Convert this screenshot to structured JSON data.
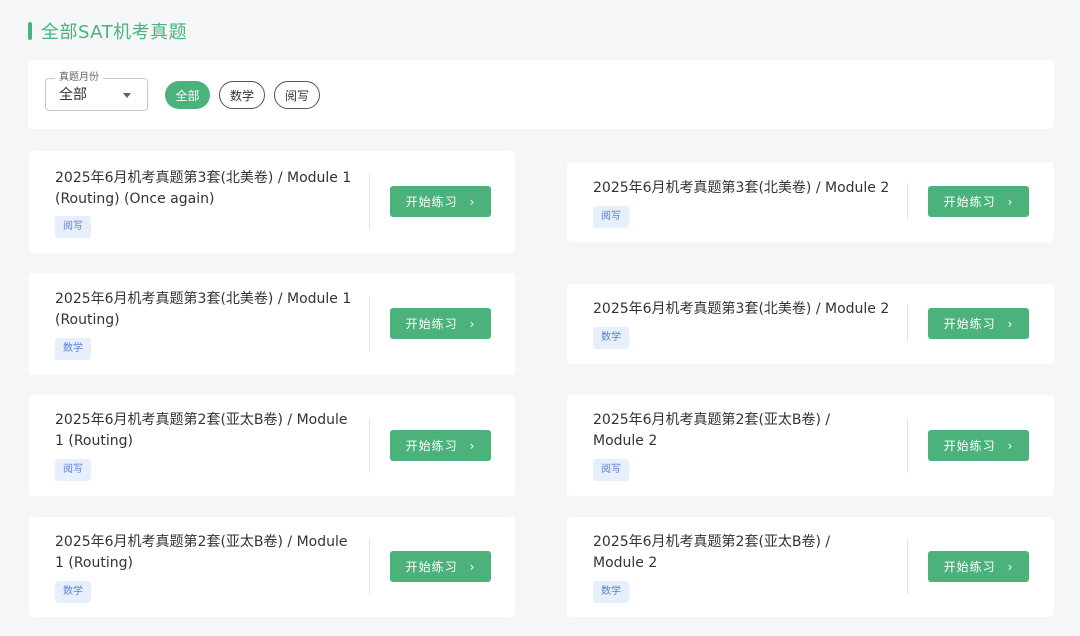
{
  "header": {
    "title": "全部SAT机考真题"
  },
  "filters": {
    "month_label": "真题月份",
    "month_value": "全部",
    "chips": [
      "全部",
      "数学",
      "阅写"
    ]
  },
  "cards": [
    {
      "title": "2025年6月机考真题第3套(北美卷) / Module 1 (Routing) (Once again)",
      "tag": "阅写",
      "button": "开始练习"
    },
    {
      "title": "2025年6月机考真题第3套(北美卷) / Module 2",
      "tag": "阅写",
      "button": "开始练习"
    },
    {
      "title": "2025年6月机考真题第3套(北美卷) / Module 1 (Routing)",
      "tag": "数学",
      "button": "开始练习"
    },
    {
      "title": "2025年6月机考真题第3套(北美卷) / Module 2",
      "tag": "数学",
      "button": "开始练习"
    },
    {
      "title": "2025年6月机考真题第2套(亚太B卷) / Module 1 (Routing)",
      "tag": "阅写",
      "button": "开始练习"
    },
    {
      "title": "2025年6月机考真题第2套(亚太B卷) / Module 2",
      "tag": "阅写",
      "button": "开始练习"
    },
    {
      "title": "2025年6月机考真题第2套(亚太B卷) / Module 1 (Routing)",
      "tag": "数学",
      "button": "开始练习"
    },
    {
      "title": "2025年6月机考真题第2套(亚太B卷) / Module 2",
      "tag": "数学",
      "button": "开始练习"
    }
  ],
  "colors": {
    "accent": "#4cb27b",
    "tag_bg": "#e8effc",
    "tag_text": "#5a7fd4"
  }
}
